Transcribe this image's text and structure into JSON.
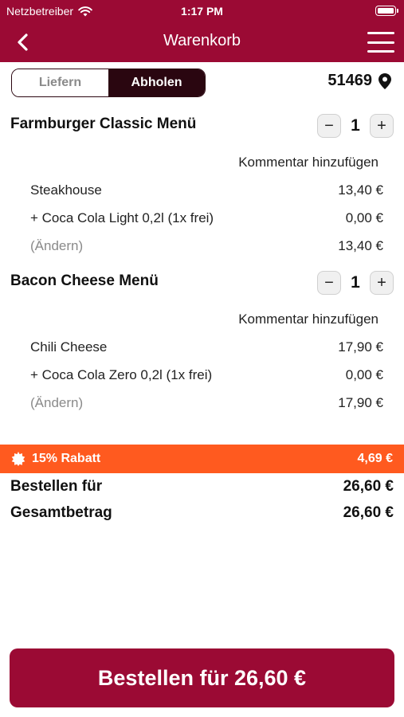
{
  "status_bar": {
    "carrier": "Netzbetreiber",
    "time": "1:17 PM"
  },
  "nav": {
    "title": "Warenkorb"
  },
  "delivery_toggle": {
    "options": [
      "Liefern",
      "Abholen"
    ],
    "selected": "Abholen"
  },
  "store": {
    "number": "51469"
  },
  "cart_items": [
    {
      "title": "Farmburger Classic Menü",
      "quantity": "1",
      "comment_label": "Kommentar hinzufügen",
      "lines": [
        {
          "label": "Steakhouse",
          "price": "13,40 €"
        },
        {
          "label": "+ Coca Cola Light 0,2l (1x frei)",
          "price": "0,00 €"
        },
        {
          "label": "(Ändern)",
          "price": "13,40 €"
        }
      ]
    },
    {
      "title": "Bacon Cheese Menü",
      "quantity": "1",
      "comment_label": "Kommentar hinzufügen",
      "lines": [
        {
          "label": "Chili Cheese",
          "price": "17,90 €"
        },
        {
          "label": "+ Coca Cola Zero 0,2l (1x frei)",
          "price": "0,00 €"
        },
        {
          "label": "(Ändern)",
          "price": "17,90 €"
        }
      ]
    }
  ],
  "discount": {
    "label": "15% Rabatt",
    "amount": "4,69 €",
    "color": "#ff5a1f"
  },
  "totals": [
    {
      "label": "Bestellen für",
      "value": "26,60 €"
    },
    {
      "label": "Gesamtbetrag",
      "value": "26,60 €"
    }
  ],
  "order_button": {
    "label": "Bestellen für 26,60 €"
  },
  "colors": {
    "brand": "#9b0a34",
    "toggle_dark": "#2a0610"
  },
  "icons": [
    "wifi-icon",
    "battery-icon",
    "back-chevron-icon",
    "hamburger-menu-icon",
    "location-pin-icon",
    "discount-badge-icon"
  ]
}
